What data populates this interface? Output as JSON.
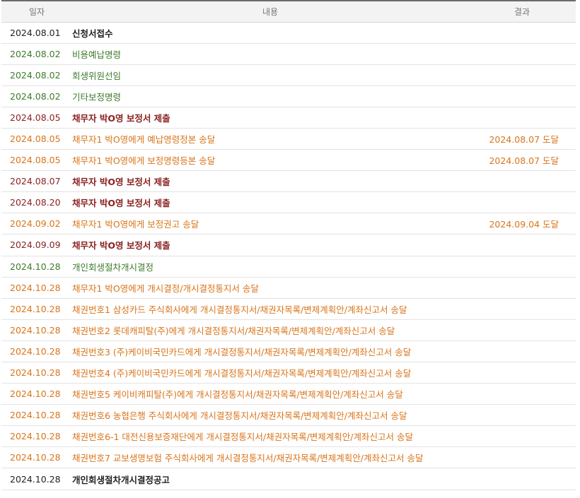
{
  "header": {
    "date": "일자",
    "content": "내용",
    "result": "결과"
  },
  "rows": [
    {
      "date": "2024.08.01",
      "content": "신청서접수",
      "result": "",
      "color": "black"
    },
    {
      "date": "2024.08.02",
      "content": "비용예납명령",
      "result": "",
      "color": "green"
    },
    {
      "date": "2024.08.02",
      "content": "회생위원선임",
      "result": "",
      "color": "green"
    },
    {
      "date": "2024.08.02",
      "content": "기타보정명령",
      "result": "",
      "color": "green"
    },
    {
      "date": "2024.08.05",
      "content": "채무자 박O영 보정서 제출",
      "result": "",
      "color": "maroon"
    },
    {
      "date": "2024.08.05",
      "content": "채무자1 박O영에게 예납명령정본 송달",
      "result": "2024.08.07 도달",
      "color": "orange"
    },
    {
      "date": "2024.08.05",
      "content": "채무자1 박O영에게 보정명령등본 송달",
      "result": "2024.08.07 도달",
      "color": "orange"
    },
    {
      "date": "2024.08.07",
      "content": "채무자 박O영 보정서 제출",
      "result": "",
      "color": "maroon"
    },
    {
      "date": "2024.08.20",
      "content": "채무자 박O영 보정서 제출",
      "result": "",
      "color": "maroon"
    },
    {
      "date": "2024.09.02",
      "content": "채무자1 박O영에게 보정권고 송달",
      "result": "2024.09.04 도달",
      "color": "orange"
    },
    {
      "date": "2024.09.09",
      "content": "채무자 박O영 보정서 제출",
      "result": "",
      "color": "maroon"
    },
    {
      "date": "2024.10.28",
      "content": "개인회생절차개시결정",
      "result": "",
      "color": "green"
    },
    {
      "date": "2024.10.28",
      "content": "채무자1 박O영에게 개시결정/개시결정통지서 송달",
      "result": "",
      "color": "orange"
    },
    {
      "date": "2024.10.28",
      "content": "채권번호1 삼성카드 주식회사에게 개시결정통지서/채권자목록/변제계획안/계좌신고서 송달",
      "result": "",
      "color": "orange"
    },
    {
      "date": "2024.10.28",
      "content": "채권번호2 롯데캐피탈(주)에게 개시결정통지서/채권자목록/변제계획안/계좌신고서 송달",
      "result": "",
      "color": "orange"
    },
    {
      "date": "2024.10.28",
      "content": "채권번호3 (주)케이비국민카드에게 개시결정통지서/채권자목록/변제계획안/계좌신고서 송달",
      "result": "",
      "color": "orange"
    },
    {
      "date": "2024.10.28",
      "content": "채권번호4 (주)케이비국민카드에게 개시결정통지서/채권자목록/변제계획안/계좌신고서 송달",
      "result": "",
      "color": "orange"
    },
    {
      "date": "2024.10.28",
      "content": "채권번호5 케이비캐피탈(주)에게 개시결정통지서/채권자목록/변제계획안/계좌신고서 송달",
      "result": "",
      "color": "orange"
    },
    {
      "date": "2024.10.28",
      "content": "채권번호6 농협은행 주식회사에게 개시결정통지서/채권자목록/변제계획안/계좌신고서 송달",
      "result": "",
      "color": "orange"
    },
    {
      "date": "2024.10.28",
      "content": "채권번호6-1 대전신용보증재단에게 개시결정통지서/채권자목록/변제계획안/계좌신고서 송달",
      "result": "",
      "color": "orange"
    },
    {
      "date": "2024.10.28",
      "content": "채권번호7 교보생명보험 주식회사에게 개시결정통지서/채권자목록/변제계획안/계좌신고서 송달",
      "result": "",
      "color": "orange"
    },
    {
      "date": "2024.10.28",
      "content": "개인회생절차개시결정공고",
      "result": "",
      "color": "black"
    }
  ],
  "colors": {
    "black": "#222222",
    "green": "#3d7a2c",
    "maroon": "#8a1f1f",
    "orange": "#d9741a",
    "header_bg": "#f3f3f3",
    "header_border": "#6b6b6b"
  }
}
